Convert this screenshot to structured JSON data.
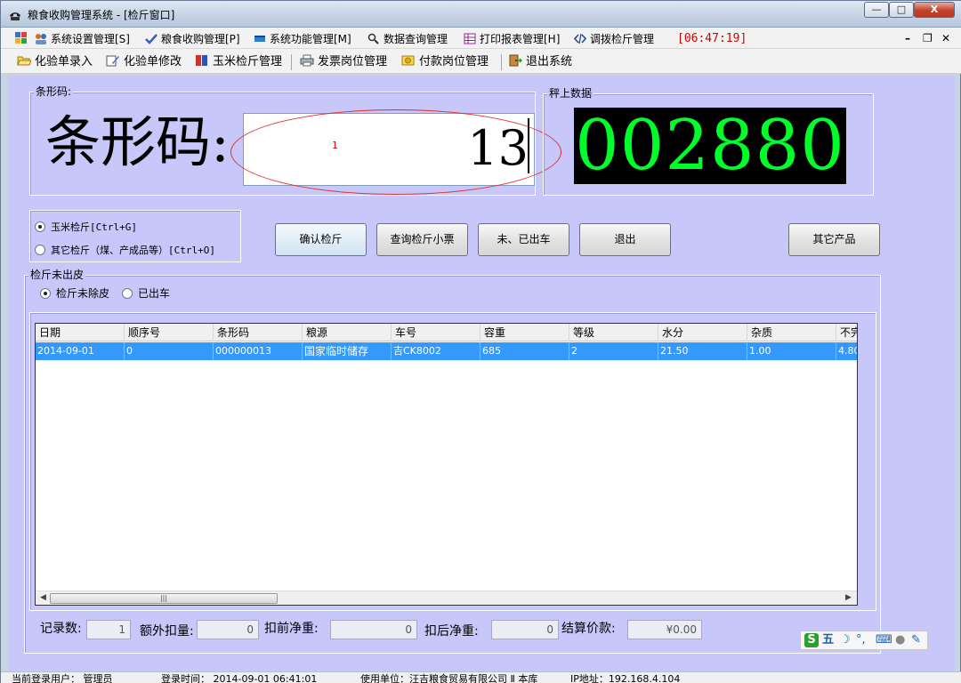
{
  "window": {
    "title": "粮食收购管理系统 - [检斤窗口]",
    "controls": {
      "minimize": "—",
      "maximize": "□",
      "close": "X"
    }
  },
  "menubar": {
    "items": [
      {
        "label": "系统设置管理[S]",
        "icon": "users-icon"
      },
      {
        "label": "粮食收购管理[P]",
        "icon": "check-icon"
      },
      {
        "label": "系统功能管理[M]",
        "icon": "window-icon"
      },
      {
        "label": "数据查询管理",
        "icon": "magnifier-icon"
      },
      {
        "label": "打印报表管理[H]",
        "icon": "table-icon"
      },
      {
        "label": "调拨检斤管理",
        "icon": "transfer-icon"
      }
    ],
    "clock": "[06:47:19]",
    "mdi_controls": {
      "minimize": "–",
      "restore": "❐",
      "close": "✕"
    }
  },
  "toolbar": {
    "items": [
      {
        "label": "化验单录入",
        "icon": "folder-open-icon"
      },
      {
        "label": "化验单修改",
        "icon": "edit-icon"
      },
      {
        "label": "玉米检斤管理",
        "icon": "corn-icon"
      },
      {
        "label": "发票岗位管理",
        "icon": "printer-icon"
      },
      {
        "label": "付款岗位管理",
        "icon": "money-icon"
      },
      {
        "label": "退出系统",
        "icon": "exit-door-icon"
      }
    ]
  },
  "barcode_group": {
    "title": "条形码:",
    "big_label": "条形码:",
    "input_value": "13",
    "annotation_label": "1"
  },
  "scale_group": {
    "title": "秤上数据",
    "reading": "002880"
  },
  "mode_options": [
    {
      "label": "玉米检斤[Ctrl+G]",
      "selected": true
    },
    {
      "label": "其它检斤（煤、产成品等）[Ctrl+O]",
      "selected": false
    }
  ],
  "buttons": {
    "confirm": "确认检斤",
    "query": "查询检斤小票",
    "not_exited": "未、已出车",
    "exit": "退出",
    "other_products": "其它产品"
  },
  "pending_group": {
    "title": "检斤未出皮",
    "filter_options": [
      {
        "label": "检斤未除皮",
        "selected": true
      },
      {
        "label": "已出车",
        "selected": false
      }
    ]
  },
  "table": {
    "columns": [
      "日期",
      "顺序号",
      "条形码",
      "粮源",
      "车号",
      "容重",
      "等级",
      "水分",
      "杂质",
      "不完"
    ],
    "rows": [
      [
        "2014-09-01",
        "0",
        "000000013",
        "国家临时储存",
        "吉CK8002",
        "685",
        "2",
        "21.50",
        "1.00",
        "4.80"
      ]
    ],
    "scroll_thumb": "|||"
  },
  "summary": {
    "record_count_label": "记录数:",
    "record_count": "1",
    "extra_deduction_label": "额外扣量:",
    "extra_deduction": "0",
    "net_before_label": "扣前净重:",
    "net_before": "0",
    "net_after_label": "扣后净重:",
    "net_after": "0",
    "settlement_label": "结算价款:",
    "settlement": "¥0.00"
  },
  "ime_bar": {
    "logo": "S",
    "mode": "五",
    "moon": "☽",
    "punct": "°,",
    "keyboard": "⌨",
    "user": "●",
    "tool": "✎"
  },
  "statusbar": {
    "user": "当前登录用户：   管理员",
    "login_time": "登录时间：  2014-09-01 06:41:01",
    "company": "使用单位：汪吉粮食贸易有限公司  Ⅱ  本库",
    "ip": "IP地址：192.168.4.104"
  }
}
